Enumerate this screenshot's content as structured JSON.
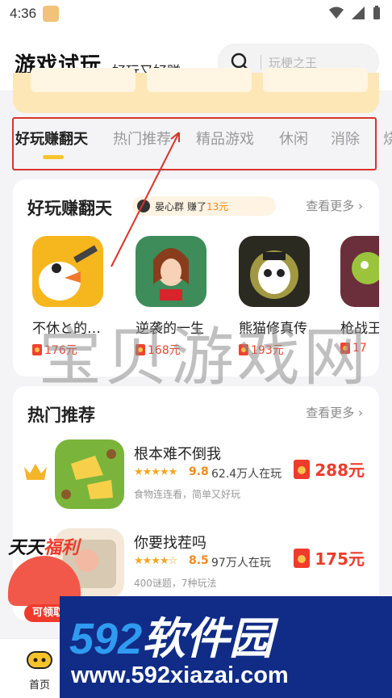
{
  "status_bar": {
    "time": "4:36"
  },
  "header": {
    "title": "游戏试玩",
    "subtitle": "好玩又好赚",
    "search_placeholder": "玩梗之王"
  },
  "tabs": [
    "好玩赚翻天",
    "热门推荐",
    "精品游戏",
    "休闲",
    "消除",
    "烧"
  ],
  "section1": {
    "title": "好玩赚翻天",
    "see_more": "查看更多 ›",
    "ticker": {
      "user": "晏心群",
      "action": "赚了",
      "amount": "13元"
    },
    "games": [
      {
        "name": "不休と的…",
        "reward": "176元"
      },
      {
        "name": "逆袭的一生",
        "reward": "168元"
      },
      {
        "name": "熊猫修真传",
        "reward": "193元"
      },
      {
        "name": "枪战王",
        "reward": "17"
      }
    ]
  },
  "section2": {
    "title": "热门推荐",
    "see_more": "查看更多 ›",
    "items": [
      {
        "name": "根本难不倒我",
        "stars": "★★★★★",
        "rating": "9.8",
        "players": "62.4万人在玩",
        "desc": "食物连连看，简单又好玩",
        "reward": "288元"
      },
      {
        "name": "你要找茬吗",
        "stars": "★★★★☆",
        "rating": "8.5",
        "players": "97万人在玩",
        "desc": "400谜题，7种玩法",
        "reward": "175元"
      }
    ]
  },
  "promo": {
    "title_a": "天天",
    "title_b": "福利",
    "button": "可领取"
  },
  "bottom_nav": {
    "home": "首页"
  },
  "watermark": {
    "text": "宝贝游戏网",
    "brand_num": "592",
    "brand_name": "软件园",
    "url": "www.592xiazai.com"
  },
  "colors": {
    "accent_yellow": "#f6c42a",
    "reward_red": "#ee3b2c",
    "annotation_red": "#d9342b",
    "rating_orange": "#f28a1a"
  }
}
